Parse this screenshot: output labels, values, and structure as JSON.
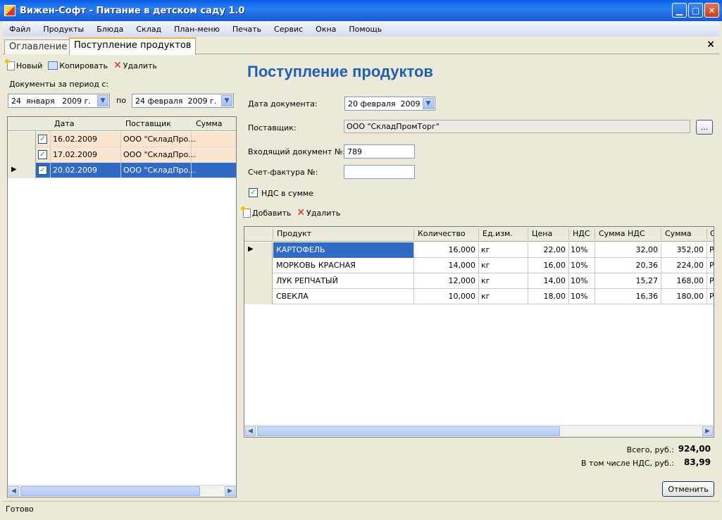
{
  "window": {
    "title": "Вижен-Софт - Питание в детском саду 1.0",
    "minimize_icon": "minimize-icon",
    "maximize_icon": "maximize-icon",
    "close_icon": "close-icon"
  },
  "menu": [
    "Файл",
    "Продукты",
    "Блюда",
    "Склад",
    "План-меню",
    "Печать",
    "Сервис",
    "Окна",
    "Помощь"
  ],
  "tabs": [
    {
      "label": "Оглавление",
      "active": false
    },
    {
      "label": "Поступление продуктов",
      "active": true
    }
  ],
  "tab_close": "×",
  "left": {
    "toolbar": {
      "new_label": "Новый",
      "copy_label": "Копировать",
      "delete_label": "Удалить"
    },
    "period_label": "Документы за период с:",
    "date_from": "24  января   2009 г.",
    "to_label": "по",
    "date_to": "24 февраля  2009 г.",
    "columns": [
      "Дата",
      "Поставщик",
      "Сумма"
    ],
    "rows": [
      {
        "checked": true,
        "date": "16.02.2009",
        "supplier": "ООО \"СкладПро...",
        "sum": ""
      },
      {
        "checked": true,
        "date": "17.02.2009",
        "supplier": "ООО \"СкладПро...",
        "sum": ""
      },
      {
        "checked": true,
        "date": "20.02.2009",
        "supplier": "ООО \"СкладПро...",
        "sum": ""
      }
    ]
  },
  "right": {
    "title": "Поступление продуктов",
    "doc_date_label": "Дата документа:",
    "doc_date": "20 февраля  2009 г.",
    "supplier_label": "Поставщик:",
    "supplier": "ООО \"СкладПромТорг\"",
    "supplier_button": "...",
    "incoming_doc_label": "Входящий документ №:",
    "incoming_doc": "789",
    "invoice_label": "Счет-фактура №:",
    "invoice": "",
    "vat_included_label": "НДС в сумме",
    "vat_included": true,
    "toolbar": {
      "add_label": "Добавить",
      "delete_label": "Удалить"
    },
    "columns": [
      "Продукт",
      "Количество",
      "Ед.изм.",
      "Цена",
      "НДС",
      "Сумма НДС",
      "Сумма",
      "С"
    ],
    "rows": [
      {
        "product": "КАРТОФЕЛЬ",
        "qty": "16,000",
        "unit": "кг",
        "price": "22,00",
        "vat": "10%",
        "vat_sum": "32,00",
        "sum": "352,00",
        "extra": "Р"
      },
      {
        "product": "МОРКОВЬ КРАСНАЯ",
        "qty": "14,000",
        "unit": "кг",
        "price": "16,00",
        "vat": "10%",
        "vat_sum": "20,36",
        "sum": "224,00",
        "extra": "Р"
      },
      {
        "product": "ЛУК РЕПЧАТЫЙ",
        "qty": "12,000",
        "unit": "кг",
        "price": "14,00",
        "vat": "10%",
        "vat_sum": "15,27",
        "sum": "168,00",
        "extra": "Р"
      },
      {
        "product": "СВЕКЛА",
        "qty": "10,000",
        "unit": "кг",
        "price": "18,00",
        "vat": "10%",
        "vat_sum": "16,36",
        "sum": "180,00",
        "extra": "Р"
      }
    ],
    "total_label": "Всего, руб.:",
    "total": "924,00",
    "vat_total_label": "В том числе НДС, руб.:",
    "vat_total": "83,99",
    "cancel_label": "Отменить"
  },
  "status": "Готово",
  "colors": {
    "selection": "#316ac5",
    "title_blue": "#1f5fb4",
    "row_peach": "#fbe5cf"
  }
}
